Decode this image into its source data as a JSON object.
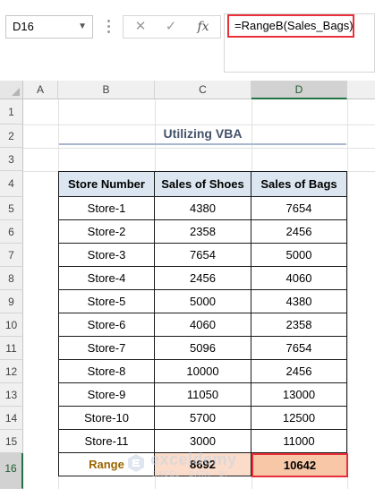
{
  "name_box": "D16",
  "formula": "=RangeB(Sales_Bags)",
  "formula_buttons": {
    "cancel": "✕",
    "enter": "✓",
    "fx": "fx"
  },
  "columns": [
    "A",
    "B",
    "C",
    "D"
  ],
  "rows": [
    "1",
    "2",
    "3",
    "4",
    "5",
    "6",
    "7",
    "8",
    "9",
    "10",
    "11",
    "12",
    "13",
    "14",
    "15",
    "16"
  ],
  "title": "Utilizing VBA",
  "table": {
    "headers": [
      "Store Number",
      "Sales of Shoes",
      "Sales of Bags"
    ],
    "rows": [
      [
        "Store-1",
        "4380",
        "7654"
      ],
      [
        "Store-2",
        "2358",
        "2456"
      ],
      [
        "Store-3",
        "7654",
        "5000"
      ],
      [
        "Store-4",
        "2456",
        "4060"
      ],
      [
        "Store-5",
        "5000",
        "4380"
      ],
      [
        "Store-6",
        "4060",
        "2358"
      ],
      [
        "Store-7",
        "5096",
        "7654"
      ],
      [
        "Store-8",
        "10000",
        "2456"
      ],
      [
        "Store-9",
        "11050",
        "13000"
      ],
      [
        "Store-10",
        "5700",
        "12500"
      ],
      [
        "Store-11",
        "3000",
        "11000"
      ]
    ],
    "range_row": [
      "Range",
      "8692",
      "10642"
    ]
  },
  "watermark": {
    "name": "exceldemy",
    "tagline": "EXCEL · DATA · BI"
  },
  "colors": {
    "accent_red": "#e8303a",
    "header_fill": "#dce6f1",
    "range_fill": "#fbdcca",
    "range_label": "#9c6500",
    "excel_green": "#217346"
  }
}
